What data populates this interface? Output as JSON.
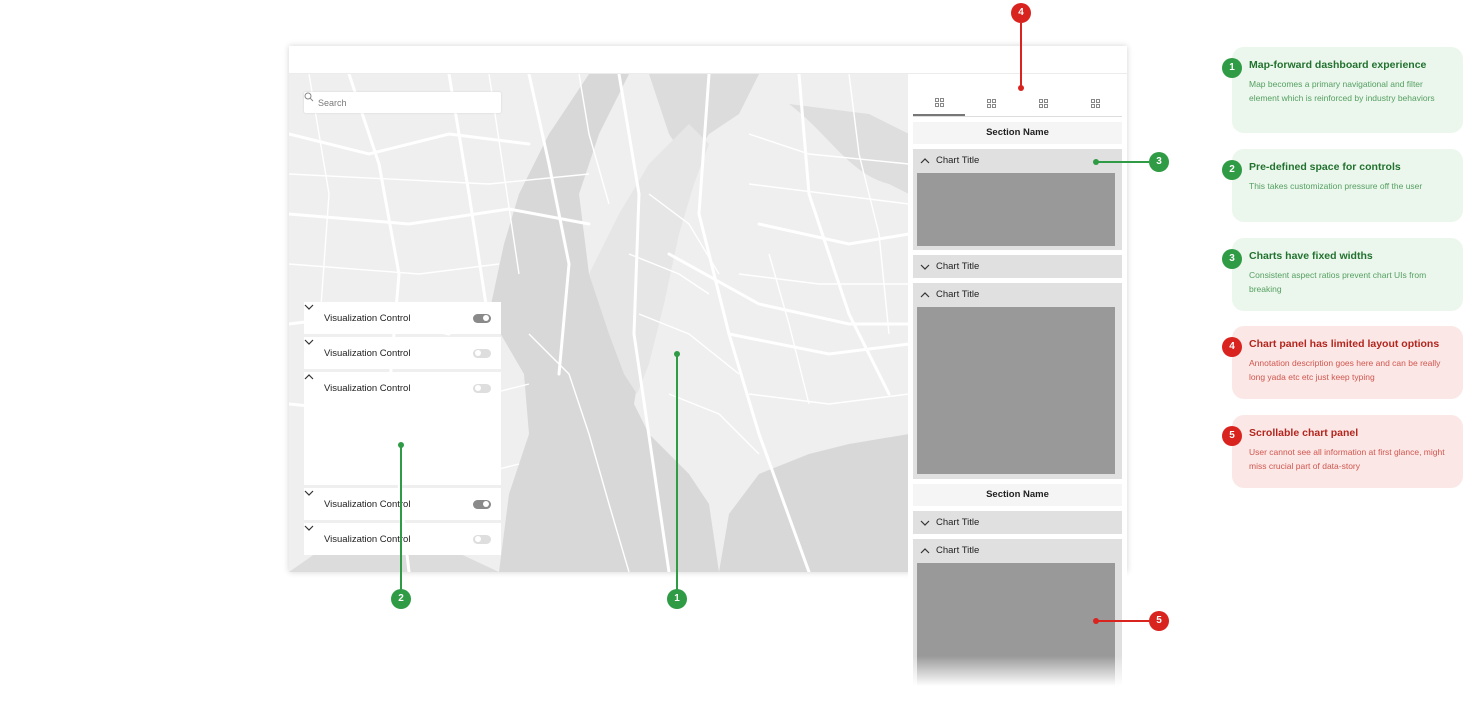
{
  "search": {
    "placeholder": "Search",
    "icon": "search-icon"
  },
  "controls": [
    {
      "label": "Visualization Control",
      "expanded": false,
      "toggle": "on"
    },
    {
      "label": "Visualization Control",
      "expanded": false,
      "toggle": "off"
    },
    {
      "label": "Visualization Control",
      "expanded": true,
      "toggle": "off"
    },
    {
      "label": "Visualization Control",
      "expanded": false,
      "toggle": "on"
    },
    {
      "label": "Visualization Control",
      "expanded": false,
      "toggle": "off"
    }
  ],
  "panel": {
    "tabs": [
      "grid-icon",
      "grid-icon",
      "grid-icon",
      "grid-icon"
    ],
    "active_tab": 0,
    "sections": [
      {
        "name": "Section Name"
      },
      {
        "name": "Section Name"
      }
    ],
    "charts": [
      {
        "title": "Chart Title",
        "expanded": true
      },
      {
        "title": "Chart Title",
        "expanded": false
      },
      {
        "title": "Chart Title",
        "expanded": true
      },
      {
        "title": "Chart Title",
        "expanded": false
      },
      {
        "title": "Chart Title",
        "expanded": true
      }
    ]
  },
  "markers": [
    "1",
    "2",
    "3",
    "4",
    "5"
  ],
  "annotations": [
    {
      "num": "1",
      "color": "green",
      "title": "Map-forward dashboard experience",
      "desc": "Map becomes a primary navigational and filter element which is reinforced by industry behaviors"
    },
    {
      "num": "2",
      "color": "green",
      "title": "Pre-defined space for controls",
      "desc": "This takes customization pressure off the user"
    },
    {
      "num": "3",
      "color": "green",
      "title": "Charts have fixed widths",
      "desc": "Consistent aspect ratios prevent chart UIs from breaking"
    },
    {
      "num": "4",
      "color": "red",
      "title": "Chart panel has limited layout options",
      "desc": "Annotation description goes here and can be really long yada etc etc just keep typing"
    },
    {
      "num": "5",
      "color": "red",
      "title": "Scrollable chart panel",
      "desc": "User cannot see all information at first glance, might miss crucial part of data-story"
    }
  ],
  "colors": {
    "green": "#2f9b45",
    "red": "#d9231f",
    "map_land": "#efefef",
    "map_water": "#d6d6d6",
    "chart_fill": "#999999"
  }
}
